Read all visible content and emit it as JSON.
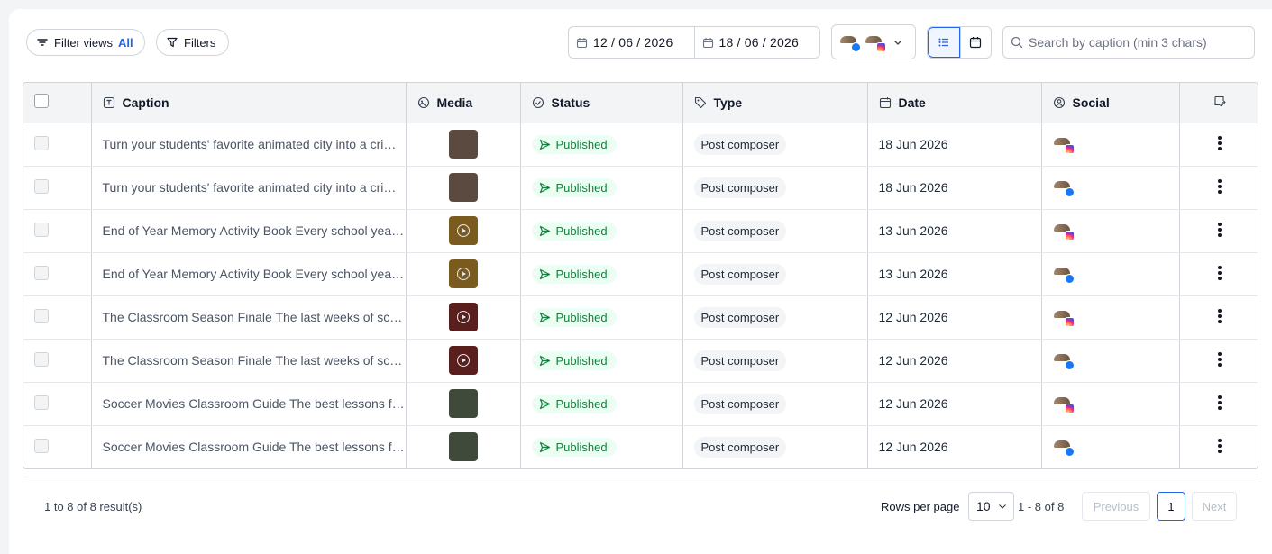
{
  "toolbar": {
    "filter_views_label": "Filter views",
    "filter_views_value": "All",
    "filters_label": "Filters",
    "date_start": "12 / 06 / 2026",
    "date_end": "18 / 06 / 2026",
    "search_placeholder": "Search by caption (min 3 chars)",
    "search_value": ""
  },
  "table": {
    "columns": {
      "caption": "Caption",
      "media": "Media",
      "status": "Status",
      "type": "Type",
      "date": "Date",
      "social": "Social"
    },
    "rows": [
      {
        "caption": "Turn your students' favorite animated city into a crime-solving lab",
        "status": "Published",
        "type": "Post composer",
        "date": "18 Jun 2026",
        "network": "instagram",
        "media_icon": "gallery",
        "thumb_color": "#5b4a3f"
      },
      {
        "caption": "Turn your students' favorite animated city into a crime-solving lab",
        "status": "Published",
        "type": "Post composer",
        "date": "18 Jun 2026",
        "network": "facebook",
        "media_icon": "gallery",
        "thumb_color": "#5b4a3f"
      },
      {
        "caption": "End of Year Memory Activity Book Every school year ends with memories",
        "status": "Published",
        "type": "Post composer",
        "date": "13 Jun 2026",
        "network": "instagram",
        "media_icon": "video",
        "thumb_color": "#7a5a1e"
      },
      {
        "caption": "End of Year Memory Activity Book Every school year ends with memories",
        "status": "Published",
        "type": "Post composer",
        "date": "13 Jun 2026",
        "network": "facebook",
        "media_icon": "video",
        "thumb_color": "#7a5a1e"
      },
      {
        "caption": "The Classroom Season Finale The last weeks of school are the best",
        "status": "Published",
        "type": "Post composer",
        "date": "12 Jun 2026",
        "network": "instagram",
        "media_icon": "video",
        "thumb_color": "#5a1f1c"
      },
      {
        "caption": "The Classroom Season Finale The last weeks of school are the best",
        "status": "Published",
        "type": "Post composer",
        "date": "12 Jun 2026",
        "network": "facebook",
        "media_icon": "video",
        "thumb_color": "#5a1f1c"
      },
      {
        "caption": "Soccer Movies Classroom Guide The best lessons from soccer films",
        "status": "Published",
        "type": "Post composer",
        "date": "12 Jun 2026",
        "network": "instagram",
        "media_icon": "gallery",
        "thumb_color": "#3f4a3a"
      },
      {
        "caption": "Soccer Movies Classroom Guide The best lessons from soccer films",
        "status": "Published",
        "type": "Post composer",
        "date": "12 Jun 2026",
        "network": "facebook",
        "media_icon": "gallery",
        "thumb_color": "#3f4a3a"
      }
    ]
  },
  "footer": {
    "result_count": "1 to 8 of 8 result(s)",
    "rows_per_page_label": "Rows per page",
    "rows_per_page_value": "10",
    "range": "1 - 8 of 8",
    "previous": "Previous",
    "current_page": "1",
    "next": "Next"
  },
  "colors": {
    "accent": "#2563eb",
    "status_green": "#15803d",
    "facebook": "#1877f2"
  }
}
